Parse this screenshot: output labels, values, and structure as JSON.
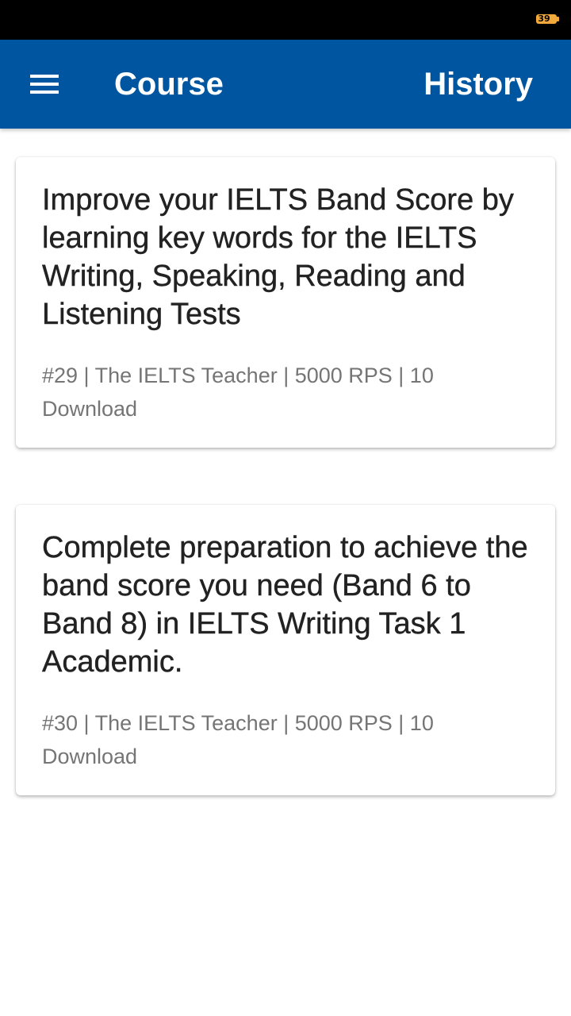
{
  "status_bar": {
    "battery_level": "39",
    "battery_color": "#f2a93b"
  },
  "app_bar": {
    "title": "Course",
    "history_label": "History",
    "menu_icon": "hamburger-menu-icon",
    "color": "#0055a0"
  },
  "courses": [
    {
      "title": "Improve your IELTS Band Score by learning key words for the IELTS Writing, Speaking, Reading and Listening Tests",
      "meta": "#29 | The IELTS Teacher | 5000 RPS | 10 Download"
    },
    {
      "title": "Complete preparation to achieve the band score you need (Band 6 to Band 8) in IELTS Writing Task 1 Academic.",
      "meta": "#30 | The IELTS Teacher | 5000 RPS | 10 Download"
    }
  ]
}
